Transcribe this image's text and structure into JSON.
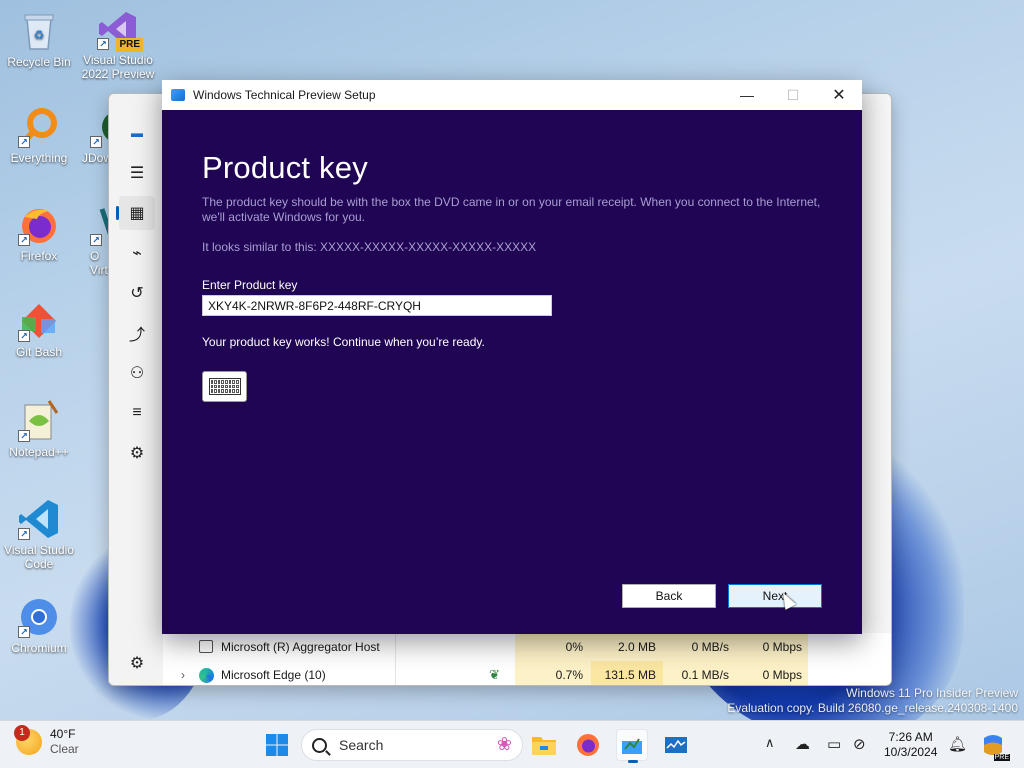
{
  "desktop": {
    "icons": [
      {
        "label": "Recycle Bin"
      },
      {
        "label": "Visual Studio 2022 Preview",
        "badge": "PRE"
      },
      {
        "label": "Everything"
      },
      {
        "label": "JDow"
      },
      {
        "label": "Firefox"
      },
      {
        "label": "O Virt"
      },
      {
        "label": "Git Bash"
      },
      {
        "label": "Notepad++"
      },
      {
        "label": "Visual Studio Code"
      },
      {
        "label": "Chromium"
      }
    ]
  },
  "taskmanager": {
    "rows": [
      {
        "name": "Microsoft (R) Aggregator Host",
        "cpu": "0%",
        "memory": "2.0 MB",
        "disk": "0 MB/s",
        "network": "0 Mbps"
      },
      {
        "name": "Microsoft Edge (10)",
        "cpu": "0.7%",
        "memory": "131.5 MB",
        "disk": "0.1 MB/s",
        "network": "0 Mbps"
      }
    ]
  },
  "setup": {
    "window_title": "Windows Technical Preview Setup",
    "heading": "Product key",
    "description": "The product key should be with the box the DVD came in or on your email receipt.  When you connect to the Internet, we'll activate Windows for you.",
    "example": "It looks similar to this: XXXXX-XXXXX-XXXXX-XXXXX-XXXXX",
    "field_label": "Enter Product key",
    "product_key": "XKY4K-2NRWR-8F6P2-448RF-CRYQH",
    "status": "Your product key works! Continue when you’re ready.",
    "back_label": "Back",
    "next_label": "Next"
  },
  "watermark": {
    "line1": "Windows 11 Pro Insider Preview",
    "line2": "Evaluation copy. Build 26080.ge_release.240308-1400"
  },
  "taskbar": {
    "weather_badge": "1",
    "temperature": "40°F",
    "condition": "Clear",
    "search_placeholder": "Search",
    "time": "7:26 AM",
    "date": "10/3/2024",
    "copilot_badge": "PRE"
  },
  "colors": {
    "setup_bg": "#1f0554",
    "accent": "#0078d7",
    "description_text": "#a99fd1"
  }
}
